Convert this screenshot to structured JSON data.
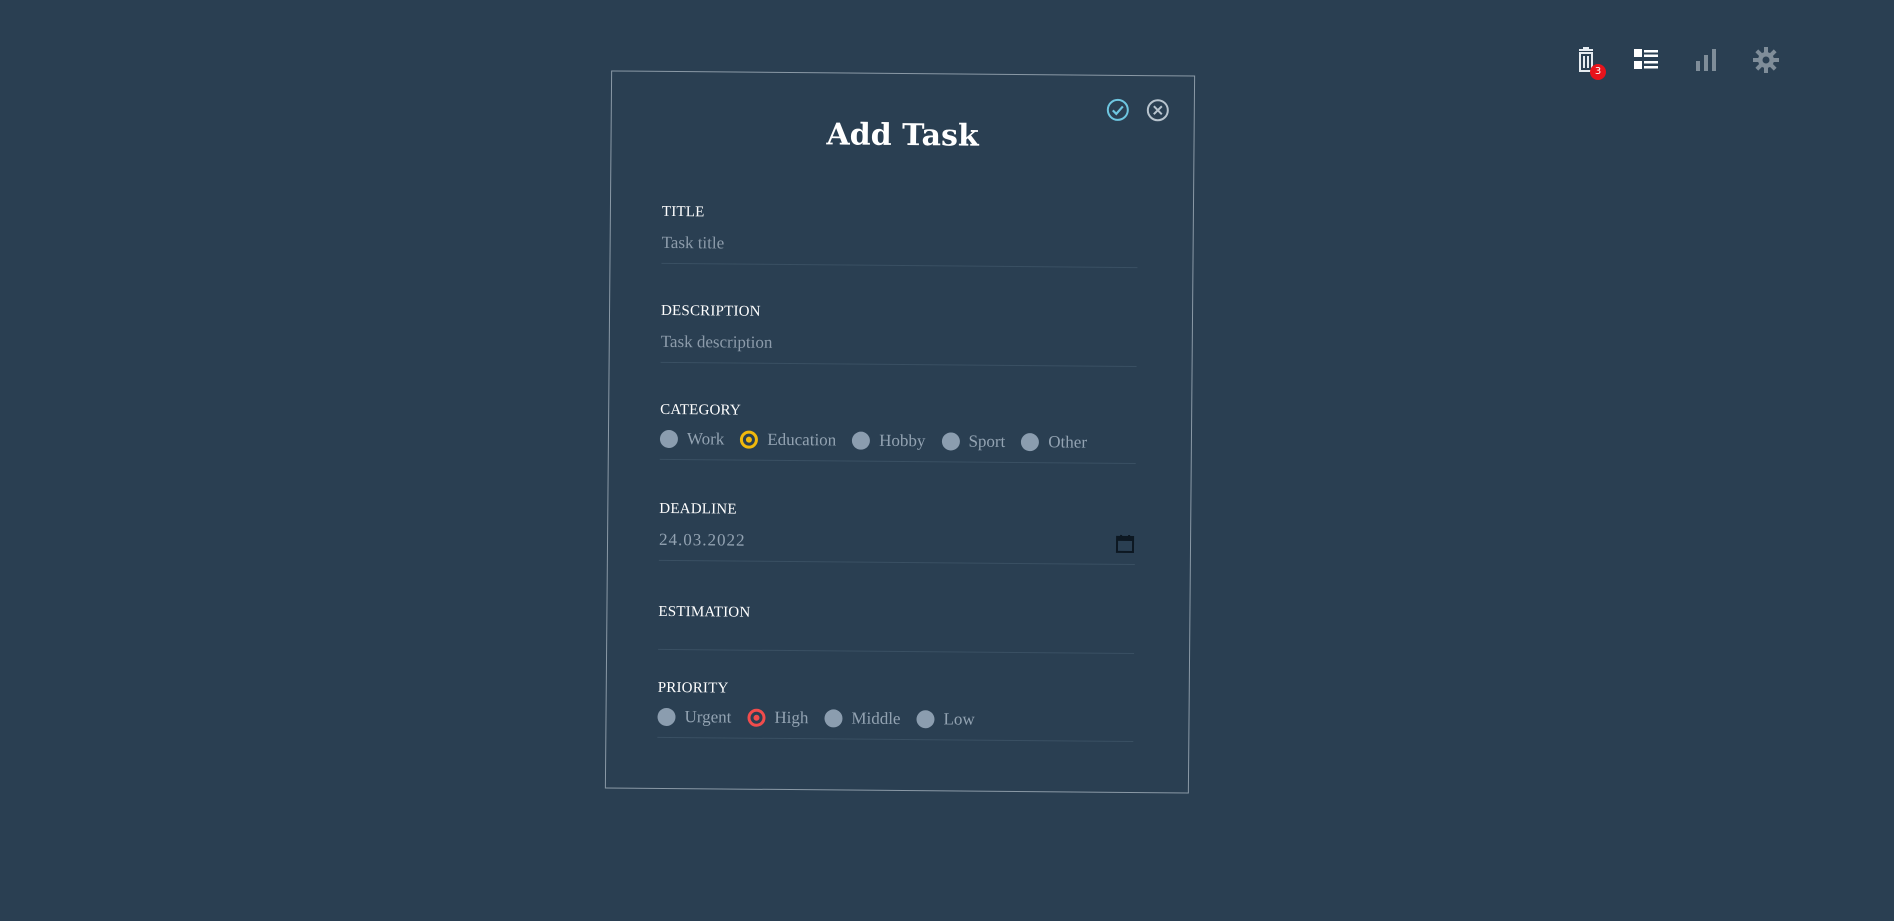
{
  "header": {
    "icons": [
      {
        "name": "tasks-trash-icon",
        "badge": "3"
      },
      {
        "name": "task-list-icon"
      },
      {
        "name": "stats-chart-icon"
      },
      {
        "name": "settings-gear-icon"
      }
    ]
  },
  "modal": {
    "title": "Add Task",
    "confirm_icon": "check-circle-icon",
    "close_icon": "close-circle-icon",
    "fields": {
      "title": {
        "label": "TITLE",
        "placeholder": "Task title",
        "value": ""
      },
      "description": {
        "label": "DESCRIPTION",
        "placeholder": "Task description",
        "value": ""
      },
      "category": {
        "label": "CATEGORY",
        "options": [
          "Work",
          "Education",
          "Hobby",
          "Sport",
          "Other"
        ],
        "selected": "Education"
      },
      "deadline": {
        "label": "DEADLINE",
        "value": "24.03.2022"
      },
      "estimation": {
        "label": "ESTIMATION"
      },
      "priority": {
        "label": "PRIORITY",
        "options": [
          "Urgent",
          "High",
          "Middle",
          "Low"
        ],
        "selected": "High"
      }
    }
  },
  "colors": {
    "background": "#2a3f52",
    "category_selected": "#f1b90d",
    "priority_selected": "#f14c4c",
    "badge": "#e8131b",
    "confirm_accent": "#6ec6e0"
  }
}
